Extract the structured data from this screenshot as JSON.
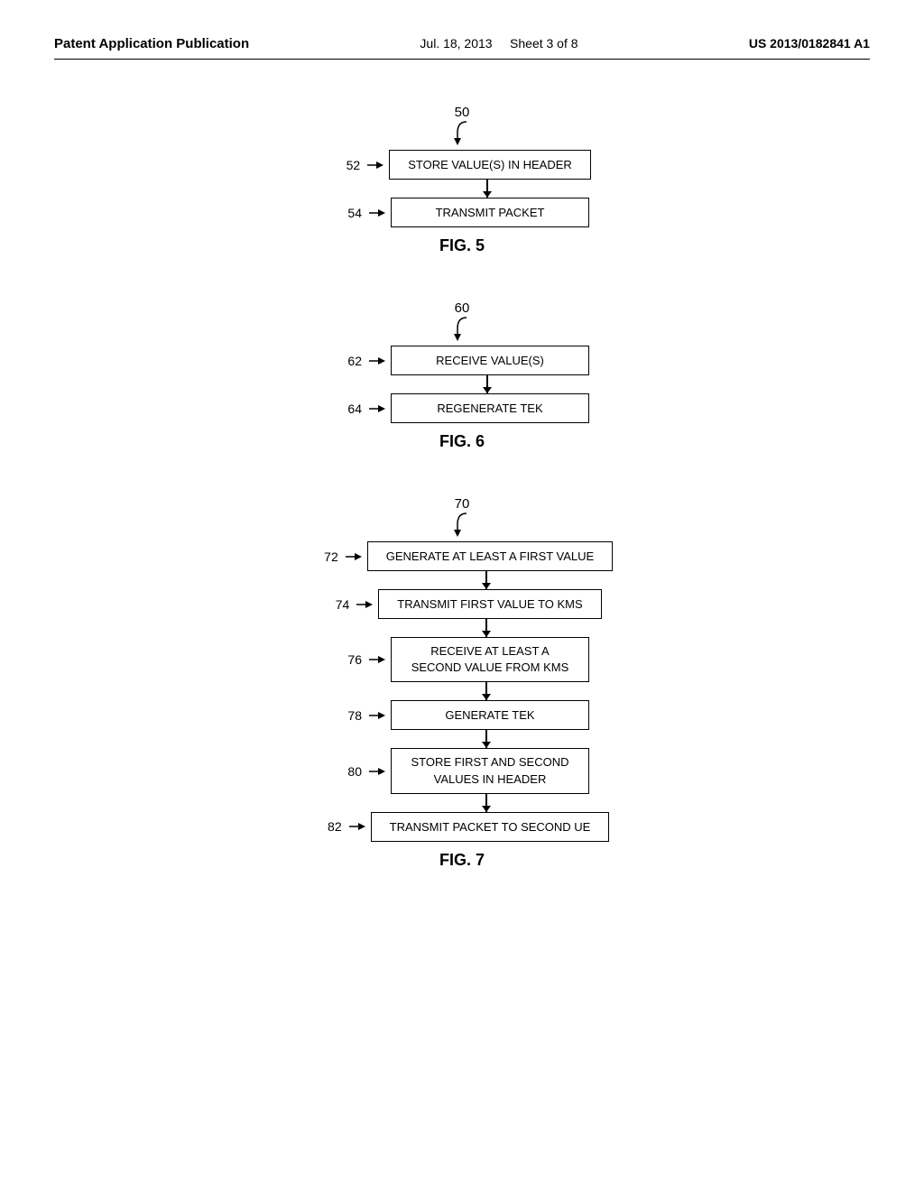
{
  "header": {
    "left": "Patent Application Publication",
    "center_date": "Jul. 18, 2013",
    "center_sheet": "Sheet 3 of 8",
    "right": "US 2013/0182841 A1"
  },
  "fig5": {
    "label": "FIG. 5",
    "start_num": "50",
    "steps": [
      {
        "id": "52",
        "text": "STORE VALUE(S) IN HEADER"
      },
      {
        "id": "54",
        "text": "TRANSMIT PACKET"
      }
    ]
  },
  "fig6": {
    "label": "FIG. 6",
    "start_num": "60",
    "steps": [
      {
        "id": "62",
        "text": "RECEIVE VALUE(S)"
      },
      {
        "id": "64",
        "text": "REGENERATE TEK"
      }
    ]
  },
  "fig7": {
    "label": "FIG. 7",
    "start_num": "70",
    "steps": [
      {
        "id": "72",
        "text": "GENERATE AT LEAST A FIRST VALUE"
      },
      {
        "id": "74",
        "text": "TRANSMIT FIRST VALUE TO KMS"
      },
      {
        "id": "76",
        "text": "RECEIVE AT LEAST A\nSECOND VALUE FROM KMS",
        "multiline": true
      },
      {
        "id": "78",
        "text": "GENERATE TEK"
      },
      {
        "id": "80",
        "text": "STORE FIRST AND SECOND\nVALUES IN HEADER",
        "multiline": true
      },
      {
        "id": "82",
        "text": "TRANSMIT PACKET TO SECOND UE"
      }
    ]
  }
}
